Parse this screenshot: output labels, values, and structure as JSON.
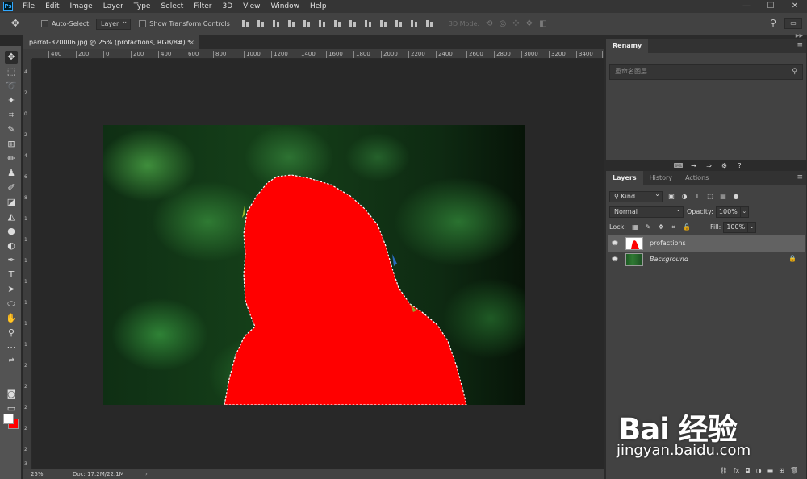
{
  "menubar": {
    "logo": "Ps",
    "items": [
      "File",
      "Edit",
      "Image",
      "Layer",
      "Type",
      "Select",
      "Filter",
      "3D",
      "View",
      "Window",
      "Help"
    ],
    "window_controls": [
      "—",
      "☐",
      "✕"
    ]
  },
  "options": {
    "auto_select_label": "Auto-Select:",
    "auto_select_target": "Layer",
    "transform_label": "Show Transform Controls",
    "mode_3d_label": "3D Mode:"
  },
  "document": {
    "tab_title": "parrot-320006.jpg @ 25% (profactions, RGB/8#) *",
    "close": "×",
    "zoom": "25%",
    "doc_size": "Doc: 17.2M/22.1M",
    "status_arrow": "›"
  },
  "ruler": {
    "h_ticks": [
      "400",
      "200",
      "0",
      "200",
      "400",
      "600",
      "800",
      "1000",
      "1200",
      "1400",
      "1600",
      "1800",
      "2000",
      "2200",
      "2400",
      "2600",
      "2800",
      "3000",
      "3200",
      "3400",
      "3600"
    ],
    "v_ticks": [
      "4",
      "2",
      "0",
      "2",
      "4",
      "6",
      "8",
      "1",
      "1",
      "1",
      "1",
      "1",
      "1",
      "1",
      "2",
      "2",
      "2",
      "2",
      "2",
      "3"
    ]
  },
  "renamy": {
    "title": "Renamy",
    "search_placeholder": "重命名图层"
  },
  "layers_panel": {
    "tabs": [
      "Layers",
      "History",
      "Actions"
    ],
    "filter_kind": "Kind",
    "blend_mode": "Normal",
    "opacity_label": "Opacity:",
    "opacity_value": "100%",
    "lock_label": "Lock:",
    "fill_label": "Fill:",
    "fill_value": "100%",
    "layers": [
      {
        "name": "profactions",
        "selected": true
      },
      {
        "name": "Background",
        "selected": false,
        "locked": true
      }
    ],
    "footer_icons": [
      "link-icon",
      "fx-icon",
      "mask-icon",
      "adjustment-icon",
      "group-icon",
      "new-layer-icon",
      "trash-icon"
    ]
  },
  "colors": {
    "foreground": "#ffffff",
    "background": "#ff0000",
    "accent": "#31a8ff",
    "selection_fill": "#ff0000"
  },
  "watermark": {
    "logo": "Bai 经验",
    "url": "jingyan.baidu.com"
  }
}
